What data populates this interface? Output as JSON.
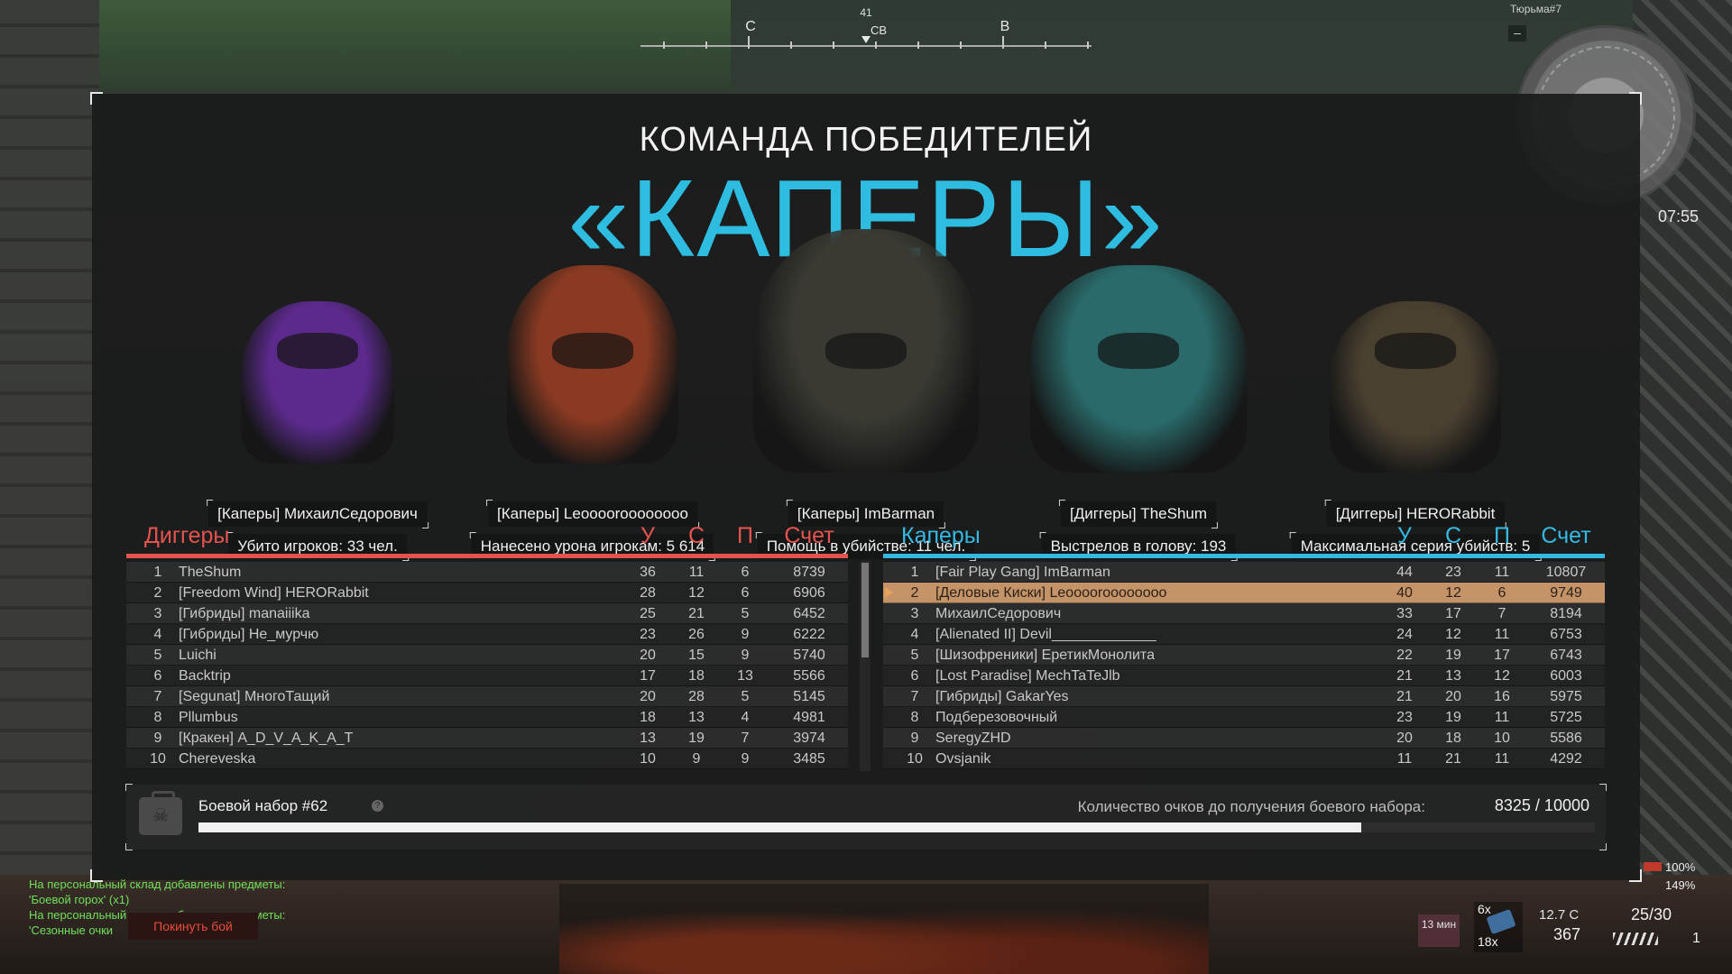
{
  "compass": {
    "degree": "41",
    "labels": [
      "С",
      "СВ",
      "В"
    ]
  },
  "minimap": {
    "map_name": "Тюрьма#7",
    "minus": "–"
  },
  "clock": "07:55",
  "header": {
    "title": "КОМАНДА ПОБЕДИТЕЛЕЙ",
    "winner_team": "«КАПЕРЫ»"
  },
  "mvp": [
    {
      "name": "[Каперы] МихаилСедорович",
      "stat": "Убито игроков: 33 чел.",
      "color": "#5b2a8c"
    },
    {
      "name": "[Каперы] Leooooroooooooo",
      "stat": "Нанесено урона игрокам: 5 614",
      "color": "#8a3a22"
    },
    {
      "name": "[Каперы] ImBarman",
      "stat": "Помощь в убийстве: 11 чел.",
      "color": "#3a3a33"
    },
    {
      "name": "[Диггеры] TheShum",
      "stat": "Выстрелов в голову: 193",
      "color": "#2a6a6a"
    },
    {
      "name": "[Диггеры] HERORabbit",
      "stat": "Максимальная серия убийств: 5",
      "color": "#4a4030"
    }
  ],
  "columns": {
    "kills": "У",
    "deaths": "С",
    "assists": "П",
    "score": "Счет"
  },
  "left_team": {
    "name": "Диггеры",
    "color": "#e5534f",
    "rows": [
      {
        "pos": "1",
        "name": "TheShum",
        "u": "36",
        "s": "11",
        "p": "6",
        "score": "8739"
      },
      {
        "pos": "2",
        "name": "[Freedom Wind] HERORabbit",
        "u": "28",
        "s": "12",
        "p": "6",
        "score": "6906"
      },
      {
        "pos": "3",
        "name": "[Гибриды] manaiiika",
        "u": "25",
        "s": "21",
        "p": "5",
        "score": "6452"
      },
      {
        "pos": "4",
        "name": "[Гибриды] Не_мурчю",
        "u": "23",
        "s": "26",
        "p": "9",
        "score": "6222"
      },
      {
        "pos": "5",
        "name": "Luichi",
        "u": "20",
        "s": "15",
        "p": "9",
        "score": "5740"
      },
      {
        "pos": "6",
        "name": "Backtrip",
        "u": "17",
        "s": "18",
        "p": "13",
        "score": "5566"
      },
      {
        "pos": "7",
        "name": "[Segunat] МногоТащий",
        "u": "20",
        "s": "28",
        "p": "5",
        "score": "5145"
      },
      {
        "pos": "8",
        "name": "Pllumbus",
        "u": "18",
        "s": "13",
        "p": "4",
        "score": "4981"
      },
      {
        "pos": "9",
        "name": "[Кракен] A_D_V_A_K_A_T",
        "u": "13",
        "s": "19",
        "p": "7",
        "score": "3974"
      },
      {
        "pos": "10",
        "name": "Chereveska",
        "u": "10",
        "s": "9",
        "p": "9",
        "score": "3485"
      }
    ]
  },
  "right_team": {
    "name": "Каперы",
    "color": "#35b9e3",
    "rows": [
      {
        "pos": "1",
        "name": "[Fair Play Gang] ImBarman",
        "u": "44",
        "s": "23",
        "p": "11",
        "score": "10807"
      },
      {
        "pos": "2",
        "name": "[Деловые Киски] Leooooroooooooo",
        "u": "40",
        "s": "12",
        "p": "6",
        "score": "9749",
        "self": true
      },
      {
        "pos": "3",
        "name": "МихаилСедорович",
        "u": "33",
        "s": "17",
        "p": "7",
        "score": "8194"
      },
      {
        "pos": "4",
        "name": "[Alienated II] Devil_____________",
        "u": "24",
        "s": "12",
        "p": "11",
        "score": "6753"
      },
      {
        "pos": "5",
        "name": "[Шизофреники] ЕретикМонолита",
        "u": "22",
        "s": "19",
        "p": "17",
        "score": "6743"
      },
      {
        "pos": "6",
        "name": "[Lost Paradise] MechTaTeJlb",
        "u": "21",
        "s": "13",
        "p": "12",
        "score": "6003"
      },
      {
        "pos": "7",
        "name": "[Гибриды] GakarYes",
        "u": "21",
        "s": "20",
        "p": "16",
        "score": "5975"
      },
      {
        "pos": "8",
        "name": "Подберезовочный",
        "u": "23",
        "s": "19",
        "p": "11",
        "score": "5725"
      },
      {
        "pos": "9",
        "name": "SeregyZHD",
        "u": "20",
        "s": "18",
        "p": "10",
        "score": "5586"
      },
      {
        "pos": "10",
        "name": "Ovsjanik",
        "u": "11",
        "s": "21",
        "p": "11",
        "score": "4292"
      }
    ]
  },
  "battle_kit": {
    "title": "Боевой набор #62",
    "help": "?",
    "icon": "kit-case-icon",
    "progress_label": "Количество очков до получения боевого набора:",
    "progress_value": "8325 / 10000",
    "progress_fraction": 0.8325
  },
  "chat": {
    "lines": [
      "На персональный склад добавлены предметы:",
      "'Боевой горох' (x1)",
      "На персональный склад добавлены предметы:",
      "'Сезонные очки"
    ]
  },
  "leave_button": "Покинуть бой",
  "hud": {
    "time_left": "13 мин",
    "grenade_x": "6x",
    "grenade_count": "18x",
    "ammo_type": "12.7 C",
    "armor": "367",
    "magazine": "25/30",
    "reserve": "1",
    "hp_percent": "100%",
    "hp_percent2": "149%"
  }
}
